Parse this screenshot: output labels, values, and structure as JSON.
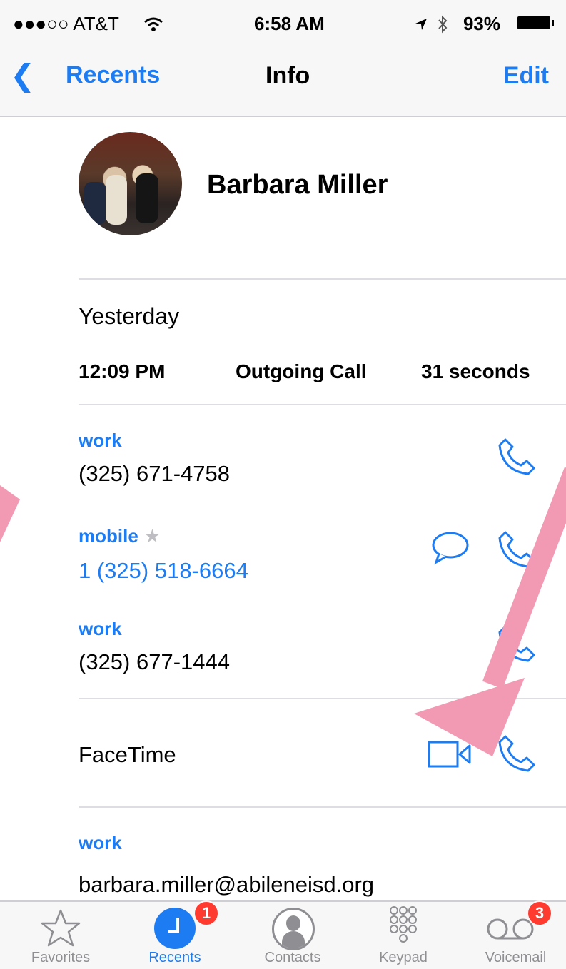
{
  "status_bar": {
    "carrier": "●●●○○ AT&T",
    "time": "6:58 AM",
    "right": "93%"
  },
  "nav": {
    "back_label": "Recents",
    "title": "Info",
    "edit_label": "Edit"
  },
  "contact": {
    "name": "Barbara Miller"
  },
  "recent_call": {
    "day": "Yesterday",
    "time": "12:09 PM",
    "type": "Outgoing Call",
    "duration": "31 seconds"
  },
  "phones": [
    {
      "label": "work",
      "number": "(325) 671-4758"
    },
    {
      "label": "mobile",
      "number": "1 (325) 518-6664",
      "favorite_mark": "★"
    },
    {
      "label": "work",
      "number": "(325) 677-1444"
    }
  ],
  "facetime": {
    "label": "FaceTime"
  },
  "email": {
    "label": "work",
    "address": "barbara.miller@abileneisd.org"
  },
  "tabs": [
    {
      "label": "Favorites",
      "icon": "star-icon"
    },
    {
      "label": "Recents",
      "icon": "clock-icon",
      "badge": "1"
    },
    {
      "label": "Contacts",
      "icon": "person-icon"
    },
    {
      "label": "Keypad",
      "icon": "keypad-icon"
    },
    {
      "label": "Voicemail",
      "icon": "voicemail-icon",
      "badge": "3"
    }
  ],
  "colors": {
    "accent": "#1e7cf2",
    "annotation_arrow": "#f29ab4",
    "badge": "#ff3b30"
  }
}
